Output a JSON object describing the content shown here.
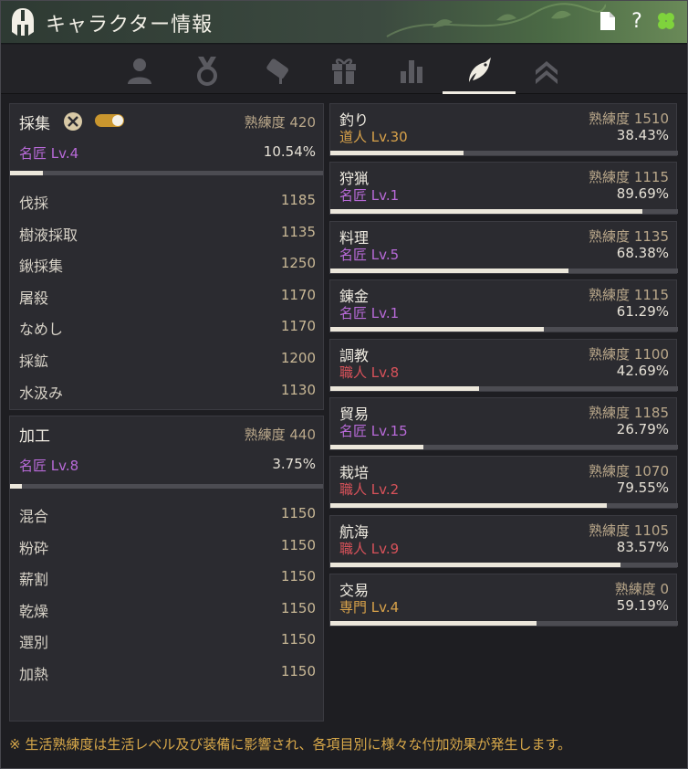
{
  "window": {
    "title": "キャラクター情報",
    "icons": [
      "helmet-icon",
      "document-icon",
      "help-icon",
      "clover-icon"
    ],
    "help_glyph": "?",
    "clover_glyph": "🍀"
  },
  "tabs": [
    {
      "name": "profile",
      "icon": "person-icon",
      "active": false
    },
    {
      "name": "medal",
      "icon": "medal-icon",
      "active": false
    },
    {
      "name": "quest",
      "icon": "scroll-icon",
      "active": false
    },
    {
      "name": "gift",
      "icon": "gift-icon",
      "active": false
    },
    {
      "name": "stats",
      "icon": "bar-chart-icon",
      "active": false
    },
    {
      "name": "life",
      "icon": "fish-icon",
      "active": true
    },
    {
      "name": "rank",
      "icon": "chevrons-up-icon",
      "active": false
    }
  ],
  "gathering": {
    "name": "採集",
    "jukuren_label": "熟練度 420",
    "grade": "名匠 Lv.4",
    "percent": "10.54%",
    "progress": 0.1054,
    "items": [
      {
        "name": "伐採",
        "value": "1185"
      },
      {
        "name": "樹液採取",
        "value": "1135"
      },
      {
        "name": "鍬採集",
        "value": "1250"
      },
      {
        "name": "屠殺",
        "value": "1170"
      },
      {
        "name": "なめし",
        "value": "1170"
      },
      {
        "name": "採鉱",
        "value": "1200"
      },
      {
        "name": "水汲み",
        "value": "1130"
      }
    ]
  },
  "processing": {
    "name": "加工",
    "jukuren_label": "熟練度 440",
    "grade": "名匠 Lv.8",
    "percent": "3.75%",
    "progress": 0.0375,
    "items": [
      {
        "name": "混合",
        "value": "1150"
      },
      {
        "name": "粉砕",
        "value": "1150"
      },
      {
        "name": "薪割",
        "value": "1150"
      },
      {
        "name": "乾燥",
        "value": "1150"
      },
      {
        "name": "選別",
        "value": "1150"
      },
      {
        "name": "加熱",
        "value": "1150"
      }
    ]
  },
  "skills": [
    {
      "name": "釣り",
      "jukuren_label": "熟練度 1510",
      "grade": "道人 Lv.30",
      "grade_color": "orange",
      "percent": "38.43%",
      "progress": 0.3843
    },
    {
      "name": "狩猟",
      "jukuren_label": "熟練度 1115",
      "grade": "名匠 Lv.1",
      "grade_color": "purple",
      "percent": "89.69%",
      "progress": 0.8969
    },
    {
      "name": "料理",
      "jukuren_label": "熟練度 1135",
      "grade": "名匠 Lv.5",
      "grade_color": "purple",
      "percent": "68.38%",
      "progress": 0.6838
    },
    {
      "name": "錬金",
      "jukuren_label": "熟練度 1115",
      "grade": "名匠 Lv.1",
      "grade_color": "purple",
      "percent": "61.29%",
      "progress": 0.6129
    },
    {
      "name": "調教",
      "jukuren_label": "熟練度 1100",
      "grade": "職人 Lv.8",
      "grade_color": "red",
      "percent": "42.69%",
      "progress": 0.4269
    },
    {
      "name": "貿易",
      "jukuren_label": "熟練度 1185",
      "grade": "名匠 Lv.15",
      "grade_color": "purple",
      "percent": "26.79%",
      "progress": 0.2679
    },
    {
      "name": "栽培",
      "jukuren_label": "熟練度 1070",
      "grade": "職人 Lv.2",
      "grade_color": "red",
      "percent": "79.55%",
      "progress": 0.7955
    },
    {
      "name": "航海",
      "jukuren_label": "熟練度 1105",
      "grade": "職人 Lv.9",
      "grade_color": "red",
      "percent": "83.57%",
      "progress": 0.8357
    },
    {
      "name": "交易",
      "jukuren_label": "熟練度 0",
      "grade": "専門 Lv.4",
      "grade_color": "orange",
      "percent": "59.19%",
      "progress": 0.5919
    }
  ],
  "footer": {
    "note": "※ 生活熟練度は生活レベル及び装備に影響され、各項目別に様々な付加効果が発生します。"
  },
  "colors": {
    "accent_bar": "#ece7db",
    "purple": "#b86ad8",
    "red": "#d8525a",
    "orange": "#d8a24a",
    "note": "#d9a94a"
  }
}
